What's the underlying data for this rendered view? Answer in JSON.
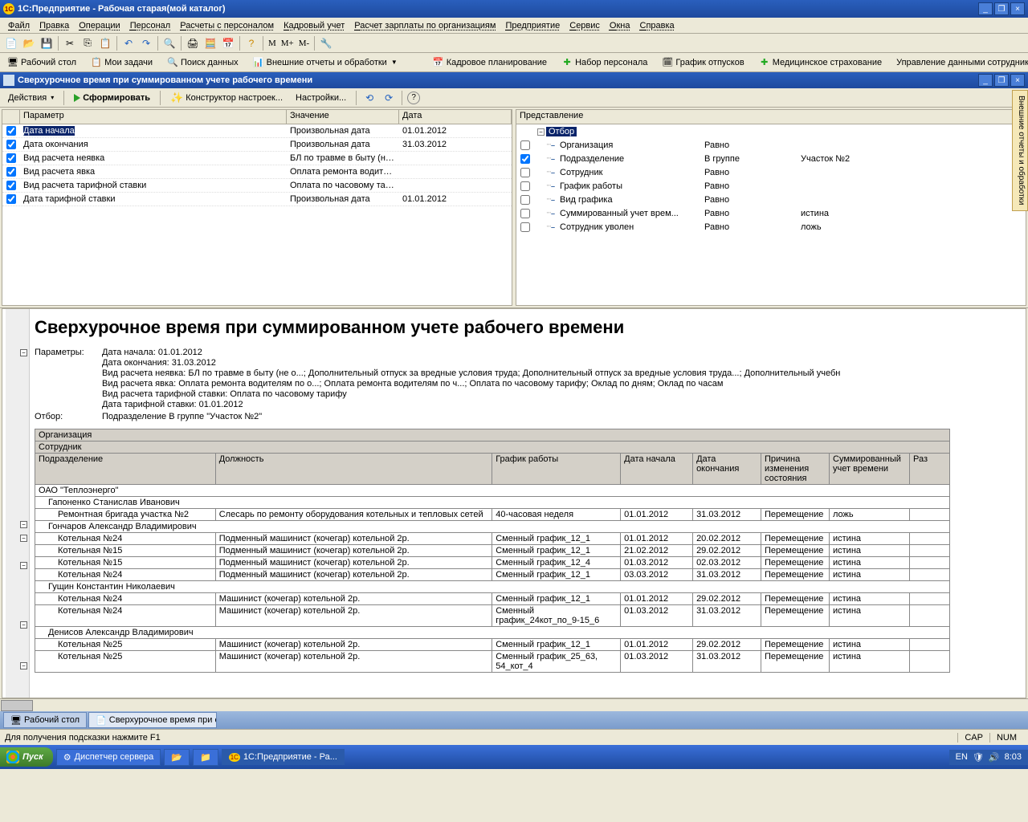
{
  "app_title": "1С:Предприятие - Рабочая старая(мой каталог)",
  "menu": [
    "Файл",
    "Правка",
    "Операции",
    "Персонал",
    "Расчеты с персоналом",
    "Кадровый учет",
    "Расчет зарплаты по организациям",
    "Предприятие",
    "Сервис",
    "Окна",
    "Справка"
  ],
  "toolbar2": {
    "desktop": "Рабочий стол",
    "tasks": "Мои задачи",
    "search": "Поиск данных",
    "ext": "Внешние отчеты и обработки",
    "hr_plan": "Кадровое планирование",
    "recruit": "Набор персонала",
    "vacation": "График отпусков",
    "med": "Медицинское страхование",
    "emp_mgmt": "Управление данными сотрудника"
  },
  "m_labels": {
    "m": "M",
    "mp": "M+",
    "mm": "M-"
  },
  "doc_title": "Сверхурочное время при суммированном учете рабочего времени",
  "doc_toolbar": {
    "actions": "Действия",
    "form": "Сформировать",
    "ctor": "Конструктор настроек...",
    "settings": "Настройки..."
  },
  "param_headers": {
    "chk": "",
    "p": "Параметр",
    "v": "Значение",
    "d": "Дата"
  },
  "params": [
    {
      "chk": true,
      "sel": true,
      "p": "Дата начала",
      "v": "Произвольная дата",
      "d": "01.01.2012"
    },
    {
      "chk": true,
      "p": "Дата окончания",
      "v": "Произвольная дата",
      "d": "31.03.2012"
    },
    {
      "chk": true,
      "p": "Вид расчета неявка",
      "v": "БЛ по травме в быту (не о...; Дополнительный отпуск з...",
      "d": ""
    },
    {
      "chk": true,
      "p": "Вид расчета явка",
      "v": "Оплата ремонта водителям по о...; Оплата ремонта вод...",
      "d": ""
    },
    {
      "chk": true,
      "p": "Вид расчета тарифной ставки",
      "v": "Оплата по часовому тарифу",
      "d": ""
    },
    {
      "chk": true,
      "p": "Дата тарифной ставки",
      "v": "Произвольная дата",
      "d": "01.01.2012"
    }
  ],
  "filter_header": "Представление",
  "filter_root": "Отбор",
  "filters": [
    {
      "chk": false,
      "name": "Организация",
      "cond": "Равно",
      "val": ""
    },
    {
      "chk": true,
      "name": "Подразделение",
      "cond": "В группе",
      "val": "Участок №2"
    },
    {
      "chk": false,
      "name": "Сотрудник",
      "cond": "Равно",
      "val": ""
    },
    {
      "chk": false,
      "name": "График работы",
      "cond": "Равно",
      "val": ""
    },
    {
      "chk": false,
      "name": "Вид графика",
      "cond": "Равно",
      "val": ""
    },
    {
      "chk": false,
      "name": "Суммированный учет врем...",
      "cond": "Равно",
      "val": "истина"
    },
    {
      "chk": false,
      "name": "Сотрудник уволен",
      "cond": "Равно",
      "val": "ложь"
    }
  ],
  "report": {
    "title": "Сверхурочное время при суммированном учете рабочего времени",
    "plabel": "Параметры:",
    "plines": [
      "Дата начала: 01.01.2012",
      "Дата окончания: 31.03.2012",
      "Вид расчета неявка: БЛ по травме в быту (не о...; Дополнительный отпуск за вредные условия труда; Дополнительный отпуск за вредные условия труда...; Дополнительный учебн",
      "Вид расчета явка: Оплата ремонта водителям по о...; Оплата ремонта водителям по ч...; Оплата по часовому тарифу; Оклад по дням; Оклад по часам",
      "Вид расчета тарифной ставки: Оплата по часовому тарифу",
      "Дата тарифной ставки: 01.01.2012"
    ],
    "olabel": "Отбор:",
    "oline": "Подразделение В группе \"Участок №2\"",
    "h_org": "Организация",
    "h_emp": "Сотрудник",
    "cols": {
      "div": "Подразделение",
      "pos": "Должность",
      "sch": "График работы",
      "d1": "Дата начала",
      "d2": "Дата окончания",
      "rsn": "Причина изменения состояния",
      "sum": "Суммированный учет времени",
      "ra": "Раз"
    },
    "org": "ОАО \"Теплоэнерго\"",
    "groups": [
      {
        "emp": "Гапоненко Станислав Иванович",
        "rows": [
          {
            "div": "Ремонтная бригада участка №2",
            "pos": "Слесарь по ремонту оборудования котельных и тепловых сетей",
            "sch": "40-часовая неделя",
            "d1": "01.01.2012",
            "d2": "31.03.2012",
            "rsn": "Перемещение",
            "sum": "ложь"
          }
        ]
      },
      {
        "emp": "Гончаров Александр Владимирович",
        "rows": [
          {
            "div": "Котельная №24",
            "pos": "Подменный  машинист (кочегар) котельной 2р.",
            "sch": "Сменный график_12_1",
            "d1": "01.01.2012",
            "d2": "20.02.2012",
            "rsn": "Перемещение",
            "sum": "истина"
          },
          {
            "div": "Котельная №15",
            "pos": "Подменный  машинист (кочегар) котельной 2р.",
            "sch": "Сменный график_12_1",
            "d1": "21.02.2012",
            "d2": "29.02.2012",
            "rsn": "Перемещение",
            "sum": "истина"
          },
          {
            "div": "Котельная №15",
            "pos": "Подменный  машинист (кочегар) котельной 2р.",
            "sch": "Сменный график_12_4",
            "d1": "01.03.2012",
            "d2": "02.03.2012",
            "rsn": "Перемещение",
            "sum": "истина"
          },
          {
            "div": "Котельная №24",
            "pos": "Подменный  машинист (кочегар) котельной 2р.",
            "sch": "Сменный график_12_1",
            "d1": "03.03.2012",
            "d2": "31.03.2012",
            "rsn": "Перемещение",
            "sum": "истина"
          }
        ]
      },
      {
        "emp": "Гущин Константин Николаевич",
        "rows": [
          {
            "div": "Котельная №24",
            "pos": "Машинист (кочегар) котельной 2р.",
            "sch": "Сменный график_12_1",
            "d1": "01.01.2012",
            "d2": "29.02.2012",
            "rsn": "Перемещение",
            "sum": "истина"
          },
          {
            "div": "Котельная №24",
            "pos": "Машинист (кочегар) котельной 2р.",
            "sch": "Сменный график_24кот_по_9-15_6",
            "d1": "01.03.2012",
            "d2": "31.03.2012",
            "rsn": "Перемещение",
            "sum": "истина"
          }
        ]
      },
      {
        "emp": "Денисов Александр Владимирович",
        "rows": [
          {
            "div": "Котельная №25",
            "pos": "Машинист (кочегар) котельной 2р.",
            "sch": "Сменный график_12_1",
            "d1": "01.01.2012",
            "d2": "29.02.2012",
            "rsn": "Перемещение",
            "sum": "истина"
          },
          {
            "div": "Котельная №25",
            "pos": "Машинист (кочегар) котельной 2р.",
            "sch": "Сменный график_25_63, 54_кот_4",
            "d1": "01.03.2012",
            "d2": "31.03.2012",
            "rsn": "Перемещение",
            "sum": "истина"
          }
        ]
      }
    ]
  },
  "wtabs": {
    "desktop": "Рабочий стол",
    "doc": "Сверхурочное время при су..."
  },
  "status": {
    "help": "Для получения подсказки нажмите F1",
    "cap": "CAP",
    "num": "NUM"
  },
  "taskbar": {
    "start": "Пуск",
    "disp": "Диспетчер сервера",
    "app": "1С:Предприятие - Ра...",
    "lang": "EN",
    "time": "8:03"
  },
  "side_tab": "Внешние отчеты и обработки"
}
